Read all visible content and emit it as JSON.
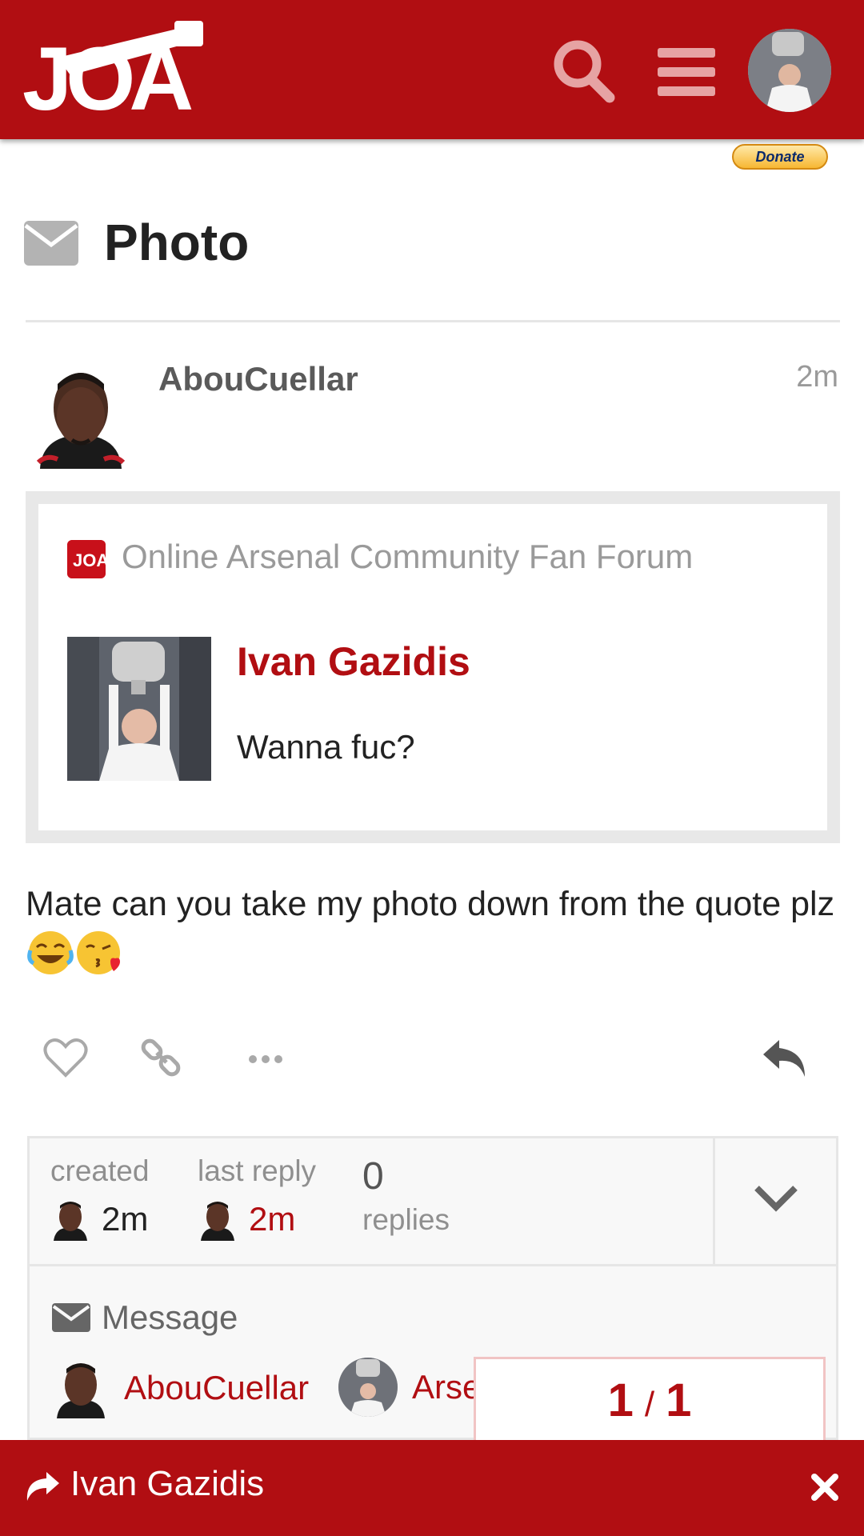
{
  "header": {
    "logo_text": "JOA",
    "icons": [
      "search-icon",
      "menu-icon"
    ],
    "avatar": "user-avatar"
  },
  "donate": {
    "label": "Donate"
  },
  "topic": {
    "title": "Photo",
    "icon": "envelope-icon"
  },
  "post": {
    "username": "AbouCuellar",
    "time": "2m",
    "onebox": {
      "site": "Online Arsenal Community Fan Forum",
      "title": "Ivan Gazidis",
      "text": "Wanna fuc?"
    },
    "body": "Mate can you take my photo down from the quote plz",
    "emojis": [
      "joy-emoji",
      "kissing-heart-emoji"
    ],
    "actions": [
      "like-icon",
      "link-icon",
      "more-icon",
      "reply-icon"
    ]
  },
  "topic_map": {
    "created_label": "created",
    "created_value": "2m",
    "last_reply_label": "last reply",
    "last_reply_value": "2m",
    "replies_count": "0",
    "replies_label": "replies",
    "message_label": "Message",
    "participants": [
      "AbouCuellar",
      "Arse"
    ]
  },
  "progress": {
    "current": "1",
    "separator": "/",
    "total": "1"
  },
  "bottom_bar": {
    "reply_target": "Ivan Gazidis"
  },
  "colors": {
    "brand": "#b10e12",
    "muted": "#9a9a9a"
  }
}
